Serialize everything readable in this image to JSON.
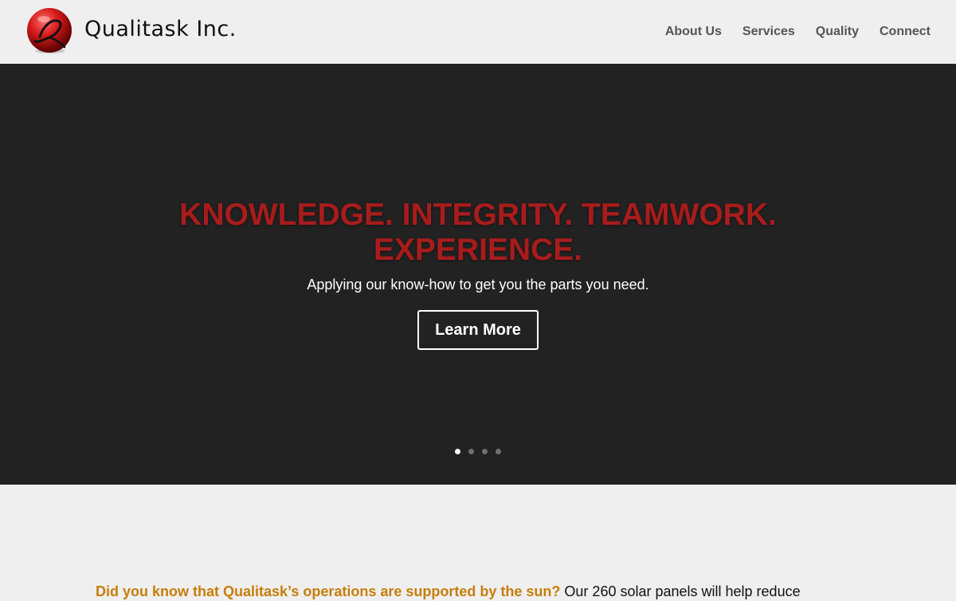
{
  "header": {
    "logo_text": "Qualitask Inc.",
    "logo_icon": "qualitask-logo-icon",
    "nav": [
      {
        "label": "About Us"
      },
      {
        "label": "Services"
      },
      {
        "label": "Quality"
      },
      {
        "label": "Connect"
      }
    ]
  },
  "hero": {
    "title_line1": "KNOWLEDGE. INTEGRITY. TEAMWORK.",
    "title_line2": "EXPERIENCE.",
    "subtitle": "Applying our know-how to get you the parts you need.",
    "button_label": "Learn More",
    "slide_count": 4,
    "active_slide": 1
  },
  "info": {
    "highlight": "Did you know that Qualitask’s operations are supported by the sun?",
    "text": " Our 260 solar panels will help reduce"
  },
  "colors": {
    "hero_background": "#222222",
    "hero_title": "#a81c1c",
    "highlight": "#c77d0a",
    "nav_text": "#555555"
  }
}
